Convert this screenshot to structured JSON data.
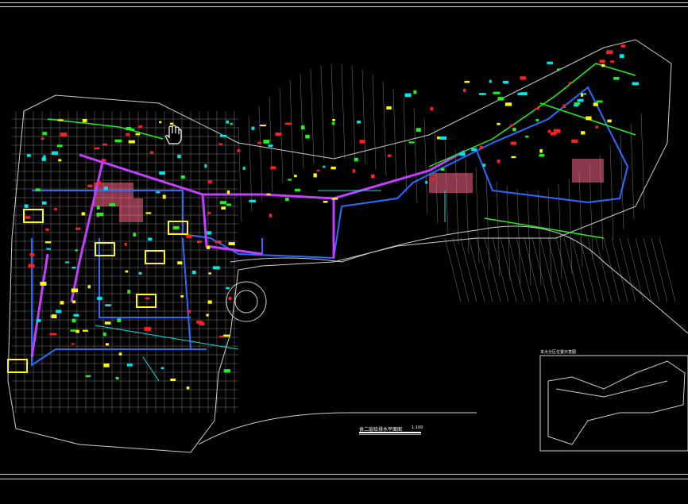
{
  "drawing": {
    "title": "食二层给排水平面图",
    "scale": "1:100",
    "inset_title": "本大分区位置示意图"
  },
  "colors": {
    "background": "#000000",
    "grid": "#9a9a9a",
    "outline": "#cfcfcf",
    "pipe_blue": "#2a6cff",
    "pipe_magenta": "#c040ff",
    "pipe_green": "#22ee22",
    "pipe_cyan": "#00e5e5",
    "pipe_yellow": "#ffff00",
    "pipe_red": "#ff2020",
    "hatch": "#ff6688"
  },
  "icons": {
    "cursor": "hand-cursor-icon"
  }
}
